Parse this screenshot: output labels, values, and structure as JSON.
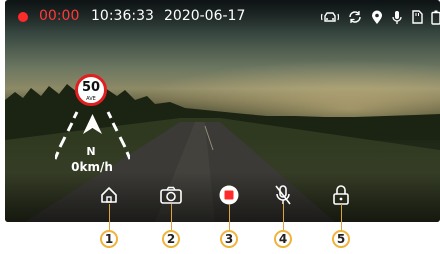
{
  "status_bar": {
    "recording_time": "00:00",
    "clock": "10:36:33",
    "date": "2020-06-17",
    "icons": [
      "car-protect-icon",
      "loop-recording-icon",
      "gps-location-icon",
      "microphone-icon",
      "sd-card-icon",
      "battery-icon"
    ]
  },
  "adas": {
    "speed_limit": "50",
    "speed_limit_sub": "AVE",
    "heading": "N",
    "speed": "0km/h"
  },
  "controls": [
    {
      "name": "home",
      "icon": "home-icon",
      "callout": "1"
    },
    {
      "name": "camera",
      "icon": "camera-icon",
      "callout": "2"
    },
    {
      "name": "record",
      "icon": "record-stop-icon",
      "callout": "3"
    },
    {
      "name": "mute",
      "icon": "microphone-mute-icon",
      "callout": "4"
    },
    {
      "name": "lock",
      "icon": "lock-icon",
      "callout": "5"
    }
  ],
  "colors": {
    "record_red": "#ff2b2b",
    "callout_accent": "#f0b33c"
  }
}
